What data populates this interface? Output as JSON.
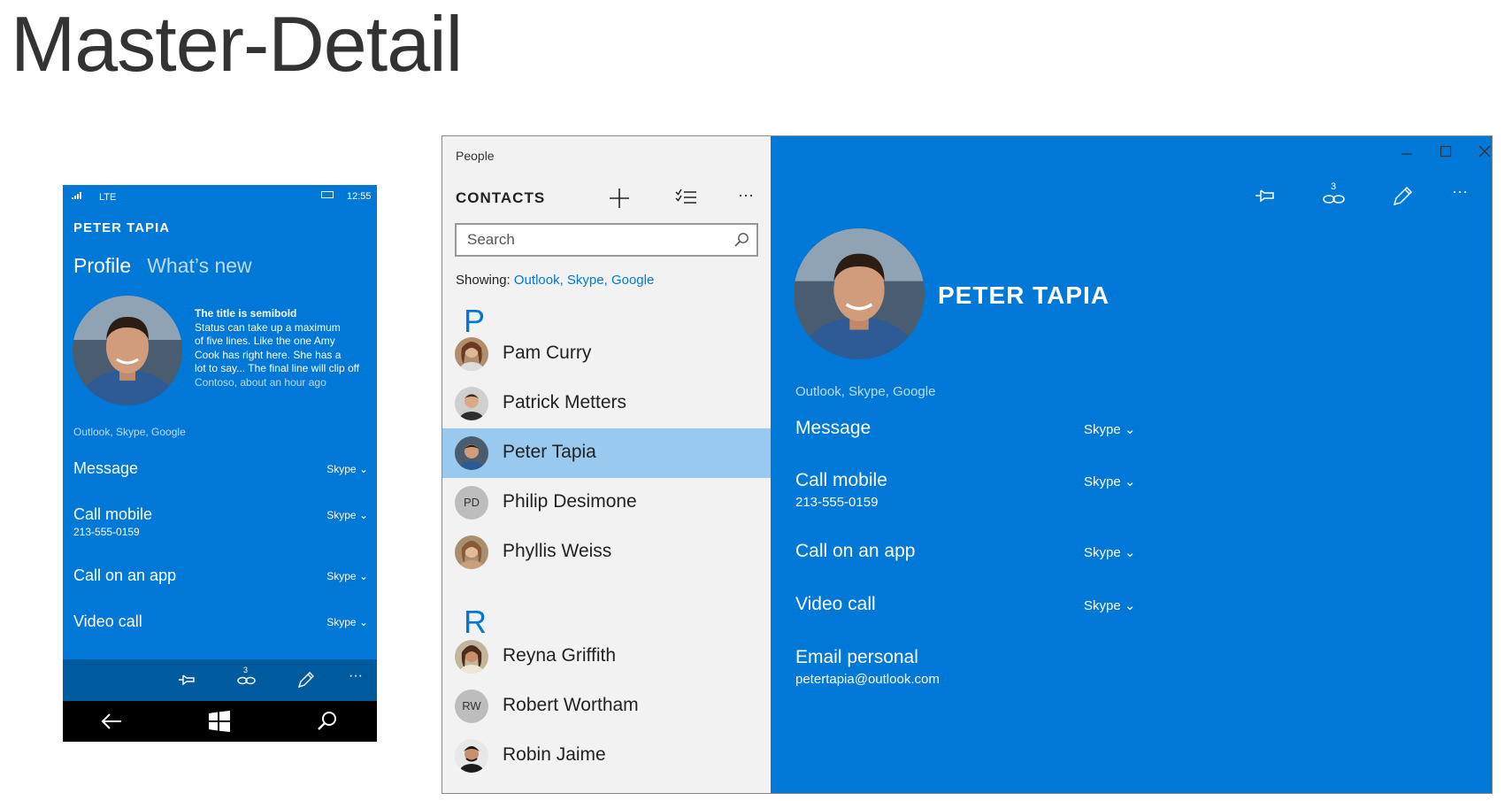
{
  "page": {
    "title": "Master-Detail"
  },
  "phone": {
    "status": {
      "signal_icon": "signal-icon",
      "network": "LTE",
      "battery_icon": "battery-icon",
      "time": "12:55"
    },
    "contact_name": "PETER TAPIA",
    "tabs": [
      {
        "label": "Profile",
        "selected": true
      },
      {
        "label": "What’s new",
        "selected": false
      }
    ],
    "status_post": {
      "title": "The title is semibold",
      "lines": [
        "Status can take up a maximum",
        "of five lines. Like the one Amy",
        "Cook has right here. She has a",
        "lot to say... The final line will clip off"
      ],
      "meta": "Contoso, about an hour ago"
    },
    "sources": "Outlook, Skype, Google",
    "actions": [
      {
        "label": "Message",
        "sub": "",
        "service": "Skype"
      },
      {
        "label": "Call mobile",
        "sub": "213-555-0159",
        "service": "Skype"
      },
      {
        "label": "Call on an app",
        "sub": "",
        "service": "Skype"
      },
      {
        "label": "Video call",
        "sub": "",
        "service": "Skype"
      }
    ],
    "commands": [
      "pin-icon",
      "link-icon",
      "edit-icon",
      "more-icon"
    ],
    "link_count": "3",
    "nav": [
      "back-icon",
      "windows-icon",
      "search-icon"
    ]
  },
  "window": {
    "app_title": "People",
    "header": "CONTACTS",
    "toolbar": [
      "add-icon",
      "select-icon",
      "more-icon"
    ],
    "search": {
      "placeholder": "Search"
    },
    "showing": {
      "label": "Showing:",
      "sources": "Outlook, Skype, Google"
    },
    "groups": [
      {
        "letter": "P",
        "contacts": [
          {
            "name": "Pam Curry",
            "initials": "",
            "selected": false
          },
          {
            "name": "Patrick Metters",
            "initials": "",
            "selected": false
          },
          {
            "name": "Peter Tapia",
            "initials": "",
            "selected": true
          },
          {
            "name": "Philip Desimone",
            "initials": "PD",
            "selected": false
          },
          {
            "name": "Phyllis Weiss",
            "initials": "",
            "selected": false
          }
        ]
      },
      {
        "letter": "R",
        "contacts": [
          {
            "name": "Reyna Griffith",
            "initials": "",
            "selected": false
          },
          {
            "name": "Robert Wortham",
            "initials": "RW",
            "selected": false
          },
          {
            "name": "Robin Jaime",
            "initials": "",
            "selected": false
          }
        ]
      }
    ],
    "controls": [
      "minimize-icon",
      "maximize-icon",
      "close-icon"
    ],
    "detail": {
      "commands": [
        "pin-icon",
        "link-icon",
        "edit-icon",
        "more-icon"
      ],
      "link_count": "3",
      "name": "PETER TAPIA",
      "sources": "Outlook, Skype, Google",
      "actions": [
        {
          "label": "Message",
          "sub": "",
          "service": "Skype"
        },
        {
          "label": "Call mobile",
          "sub": "213-555-0159",
          "service": "Skype"
        },
        {
          "label": "Call on an app",
          "sub": "",
          "service": "Skype"
        },
        {
          "label": "Video call",
          "sub": "",
          "service": "Skype"
        },
        {
          "label": "Email personal",
          "sub": "petertapia@outlook.com",
          "service": ""
        }
      ]
    }
  },
  "colors": {
    "accent": "#0078d7",
    "selected_row": "#99c9ef",
    "command_bar": "#005a9e",
    "list_bg": "#f2f2f2"
  }
}
